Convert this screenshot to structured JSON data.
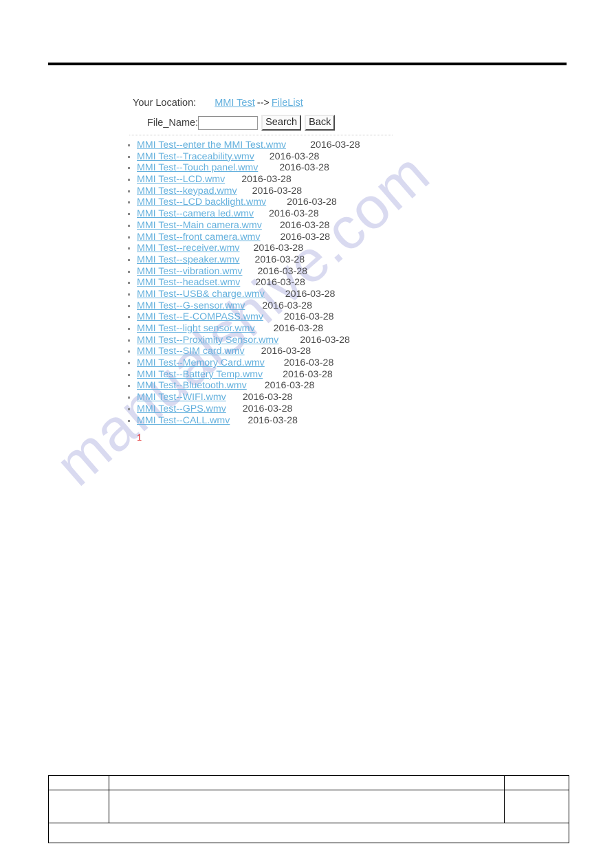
{
  "watermark": {
    "text": "manualshive.com"
  },
  "location_bar": {
    "label": "Your Location:",
    "links": [
      {
        "text": "MMI Test"
      },
      {
        "text": "FileList"
      }
    ],
    "separator": "-->"
  },
  "search": {
    "label": "File_Name:",
    "value": "",
    "placeholder": "",
    "search_button": "Search",
    "back_button": "Back"
  },
  "files": [
    {
      "name": "MMI Test--enter the MMI Test.wmv",
      "date": "2016-03-28"
    },
    {
      "name": "MMI Test--Traceability.wmv",
      "date": "2016-03-28"
    },
    {
      "name": "MMI Test--Touch panel.wmv",
      "date": "2016-03-28"
    },
    {
      "name": "MMI Test--LCD.wmv",
      "date": "2016-03-28"
    },
    {
      "name": "MMI Test--keypad.wmv",
      "date": "2016-03-28"
    },
    {
      "name": "MMI Test--LCD backlight.wmv",
      "date": "2016-03-28"
    },
    {
      "name": "MMI Test--camera led.wmv",
      "date": "2016-03-28"
    },
    {
      "name": "MMI Test--Main camera.wmv",
      "date": "2016-03-28"
    },
    {
      "name": "MMI Test--front camera.wmv",
      "date": "2016-03-28"
    },
    {
      "name": "MMI Test--receiver.wmv",
      "date": "2016-03-28"
    },
    {
      "name": "MMI Test--speaker.wmv",
      "date": "2016-03-28"
    },
    {
      "name": "MMI Test--vibration.wmv",
      "date": "2016-03-28"
    },
    {
      "name": "MMI Test--headset.wmv",
      "date": "2016-03-28"
    },
    {
      "name": "MMI Test--USB& charge.wmv",
      "date": "2016-03-28"
    },
    {
      "name": "MMI Test--G-sensor.wmv",
      "date": "2016-03-28"
    },
    {
      "name": "MMI Test--E-COMPASS.wmv",
      "date": "2016-03-28"
    },
    {
      "name": "MMI Test--light sensor.wmv",
      "date": "2016-03-28"
    },
    {
      "name": "MMI Test--Proximity Sensor.wmv",
      "date": "2016-03-28"
    },
    {
      "name": "MMI Test--SIM card.wmv",
      "date": "2016-03-28"
    },
    {
      "name": "MMI Test--Memory Card.wmv",
      "date": "2016-03-28"
    },
    {
      "name": "MMI Test--Battery Temp.wmv",
      "date": "2016-03-28"
    },
    {
      "name": "MMI Test--Bluetooth.wmv",
      "date": "2016-03-28"
    },
    {
      "name": "MMI Test--WIFI.wmv",
      "date": "2016-03-28"
    },
    {
      "name": "MMI Test--GPS.wmv",
      "date": "2016-03-28"
    },
    {
      "name": "MMI Test--CALL.wmv",
      "date": "2016-03-28"
    }
  ],
  "pagination": {
    "current_page": "1"
  },
  "footer_table": {
    "rows": [
      {
        "cells": [
          "",
          "",
          ""
        ]
      },
      {
        "cells": [
          "",
          "",
          ""
        ]
      },
      {
        "cells": [
          ""
        ]
      }
    ]
  },
  "colors": {
    "link": "#63b0dd",
    "date_text": "#4a4a4a",
    "page_number": "#e01b1b",
    "rule": "#000000",
    "watermark": "#d9daf0"
  }
}
